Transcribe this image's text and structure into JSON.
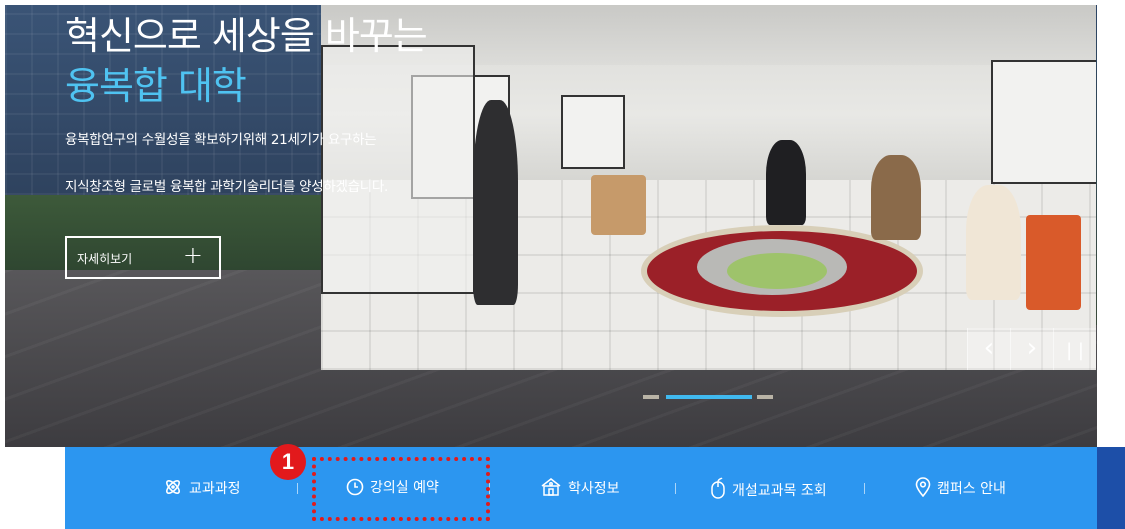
{
  "hero": {
    "title_line1": "혁신으로 세상을 바꾸는",
    "title_line2": "융복합 대학",
    "desc_line1": "융복합연구의 수월성을 확보하기위해 21세기가 요구하는",
    "desc_line2": "지식창조형 글로벌 융복합 과학기술리더를 양성하겠습니다.",
    "more_label": "자세히보기",
    "more_icon": "plus-icon",
    "title_accent_color": "#4fc3f1"
  },
  "slider": {
    "prev_icon": "chevron-left-icon",
    "next_icon": "chevron-right-icon",
    "pause_icon": "pause-icon",
    "pages": 3,
    "active_page": 2,
    "active_color": "#40b9ef"
  },
  "nav": {
    "bg_color": "#2c96f0",
    "items": [
      {
        "label": "교과과정",
        "icon": "atom-icon"
      },
      {
        "label": "강의실 예약",
        "icon": "clock-icon"
      },
      {
        "label": "학사정보",
        "icon": "school-icon"
      },
      {
        "label": "개설교과목 조회",
        "icon": "mouse-icon"
      },
      {
        "label": "캠퍼스 안내",
        "icon": "location-pin-icon"
      }
    ]
  },
  "annotation": {
    "badge_number": "1",
    "highlight_color": "#e01c1c"
  }
}
